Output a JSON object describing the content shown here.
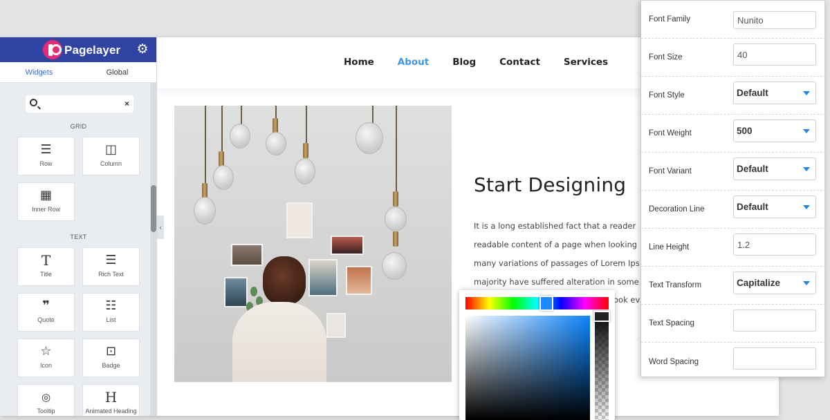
{
  "panel": {
    "brand": "Pagelayer",
    "tabs": [
      "Widgets",
      "Global"
    ],
    "search_placeholder": "",
    "sections": {
      "grid": "GRID",
      "text": "TEXT"
    },
    "widgets": [
      {
        "label": "Row",
        "icon": "rows-icon",
        "glyph": "☰"
      },
      {
        "label": "Column",
        "icon": "columns-icon",
        "glyph": "◫"
      },
      {
        "label": "Inner Row",
        "icon": "inner-row-icon",
        "glyph": "▦"
      },
      {
        "label": "Title",
        "icon": "title-icon",
        "glyph": "T"
      },
      {
        "label": "Rich Text",
        "icon": "rich-text-icon",
        "glyph": "☰"
      },
      {
        "label": "Quote",
        "icon": "quote-icon",
        "glyph": "❞"
      },
      {
        "label": "List",
        "icon": "list-icon",
        "glyph": "☷"
      },
      {
        "label": "Icon",
        "icon": "star-icon",
        "glyph": "☆"
      },
      {
        "label": "Badge",
        "icon": "badge-icon",
        "glyph": "⊡"
      },
      {
        "label": "Tooltip",
        "icon": "tooltip-icon",
        "glyph": "💬"
      },
      {
        "label": "Animated Heading",
        "icon": "heading-icon",
        "glyph": "H"
      }
    ]
  },
  "nav": [
    "Home",
    "About",
    "Blog",
    "Contact",
    "Services"
  ],
  "nav_active": "About",
  "content": {
    "heading": "Start Designing",
    "lines": [
      "It is a long established fact that a reader",
      "readable content of a page when looking",
      "many variations of passages of Lorem Ips",
      "majority have suffered alteration in some",
      "ook eve"
    ]
  },
  "props": [
    {
      "label": "Font Family",
      "kind": "input",
      "value": "Nunito"
    },
    {
      "label": "Font Size",
      "kind": "input",
      "value": "40"
    },
    {
      "label": "Font Style",
      "kind": "select",
      "value": "Default"
    },
    {
      "label": "Font Weight",
      "kind": "select",
      "value": "500"
    },
    {
      "label": "Font Variant",
      "kind": "select",
      "value": "Default"
    },
    {
      "label": "Decoration Line",
      "kind": "select",
      "value": "Default"
    },
    {
      "label": "Line Height",
      "kind": "input",
      "value": "1.2"
    },
    {
      "label": "Text Transform",
      "kind": "select",
      "value": "Capitalize"
    },
    {
      "label": "Text Spacing",
      "kind": "input",
      "value": ""
    },
    {
      "label": "Word Spacing",
      "kind": "input",
      "value": ""
    }
  ],
  "colors": {
    "header_blue": "#2f43a3",
    "brand_pink": "#e62b74",
    "accent": "#3b95e8",
    "picker_hue": "#1e88ff"
  }
}
